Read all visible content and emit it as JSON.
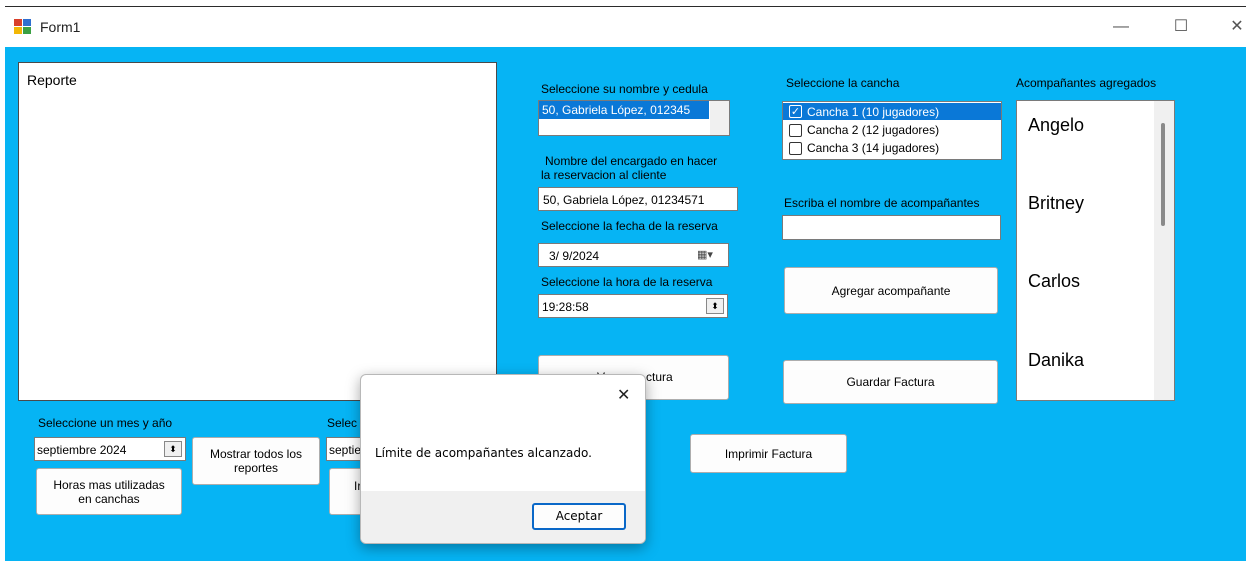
{
  "window": {
    "title": "Form1",
    "minimize_glyph": "—",
    "maximize_glyph": "☐",
    "close_glyph": "✕"
  },
  "report": {
    "label": "Reporte"
  },
  "client": {
    "label": "Seleccione su nombre y cedula",
    "selected": "50, Gabriela López, 012345"
  },
  "manager": {
    "label_line1": "Nombre del encargado en hacer",
    "label_line2": "la reservacion al cliente",
    "value": "50, Gabriela López, 01234571"
  },
  "date": {
    "label": "Seleccione la fecha de la reserva",
    "value": "3/  9/2024",
    "calendar_glyph": "▦▾"
  },
  "time": {
    "label": "Seleccione la hora de la reserva",
    "value": "19:28:58",
    "spin_glyph": "⬍"
  },
  "court": {
    "label": "Seleccione la cancha",
    "items": [
      {
        "label": "Cancha 1 (10 jugadores)",
        "checked": true
      },
      {
        "label": "Cancha 2 (12 jugadores)",
        "checked": false
      },
      {
        "label": "Cancha 3 (14 jugadores)",
        "checked": false
      }
    ]
  },
  "companion": {
    "label": "Escriba el nombre de  acompañantes",
    "value": "",
    "add_button": "Agregar acompañante"
  },
  "added": {
    "label": "Acompañantes agregados",
    "items": [
      "Angelo",
      "Britney",
      "Carlos",
      "Danika"
    ]
  },
  "buttons": {
    "ver_factura_left": "Ve",
    "ver_factura_right": "ctura",
    "guardar_factura": "Guardar Factura",
    "imprimir_factura": "Imprimir Factura",
    "mostrar_line1": "Mostrar todos los",
    "mostrar_line2": "reportes",
    "horas_line1": "Horas mas utilizadas",
    "horas_line2": "en canchas",
    "hidden_button_partial": "Ir"
  },
  "month": {
    "label": "Seleccione un mes y año",
    "value": "septiembre 2024",
    "spin_glyph": "⬍"
  },
  "second_month": {
    "label_partial": "Selec",
    "value_partial": "septie"
  },
  "dialog": {
    "message": "Límite de acompañantes alcanzado.",
    "ok": "Aceptar",
    "close_glyph": "✕"
  }
}
